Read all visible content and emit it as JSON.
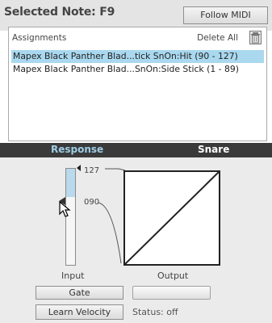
{
  "header": {
    "selected_note_label": "Selected Note: F9",
    "follow_midi_label": "Follow MIDI"
  },
  "assignments": {
    "title": "Assignments",
    "delete_all_label": "Delete All",
    "items": [
      {
        "text": "Mapex Black Panther Blad...tick SnOn:Hit (90 - 127)",
        "selected": true
      },
      {
        "text": "Mapex Black Panther Blad...SnOn:Side Stick (1 - 89)",
        "selected": false
      }
    ]
  },
  "tabs": {
    "response": "Response",
    "snare": "Snare"
  },
  "response": {
    "input_label": "Input",
    "output_label": "Output",
    "range_top_label": "127",
    "range_bottom_label": "090",
    "range_top_fraction": 1.0,
    "range_bottom_fraction": 0.709
  },
  "controls": {
    "gate_label": "Gate",
    "learn_velocity_label": "Learn Velocity",
    "status_text": "Status: off"
  },
  "colors": {
    "accent": "#9fcde6",
    "selection": "#a9d8ef"
  }
}
